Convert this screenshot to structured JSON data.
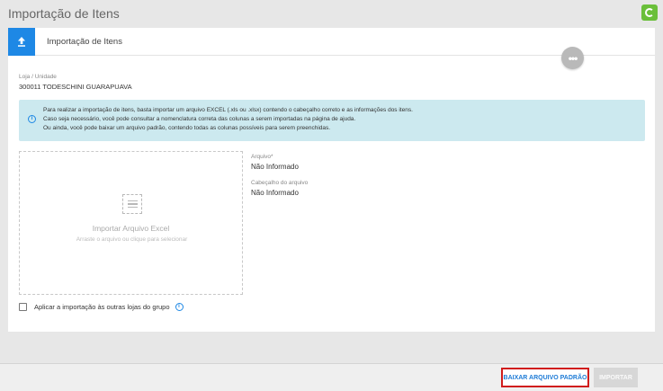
{
  "header": {
    "title": "Importação de Itens",
    "corner_icon": "refresh-icon"
  },
  "card": {
    "title": "Importação de Itens",
    "upload_icon": "upload-icon"
  },
  "more_button": {
    "label": "•••"
  },
  "store": {
    "label": "Loja / Unidade",
    "value": "300011 TODESCHINI GUARAPUAVA"
  },
  "info": {
    "lines": [
      "Para realizar a importação de itens, basta importar um arquivo EXCEL (.xls ou .xlsx) contendo o cabeçalho correto e as informações dos itens.",
      "Caso seja necessário, você pode consultar a nomenclatura correta das colunas a serem importadas na página de ajuda.",
      "Ou ainda, você pode baixar um arquivo padrão, contendo todas as colunas possíveis para serem preenchidas."
    ]
  },
  "dropzone": {
    "title": "Importar Arquivo Excel",
    "subtitle": "Arraste o arquivo ou clique para selecionar"
  },
  "fields": {
    "file": {
      "label": "Arquivo*",
      "value": "Não Informado"
    },
    "header": {
      "label": "Cabeçalho do arquivo",
      "value": "Não Informado"
    }
  },
  "apply_group": {
    "label": "Aplicar a importação às outras lojas do grupo",
    "checked": false
  },
  "footer": {
    "download_label": "BAIXAR ARQUIVO PADRÃO",
    "import_label": "IMPORTAR"
  },
  "colors": {
    "accent": "#1e88e5",
    "info_bg": "#cce9ef",
    "highlight_border": "#d01c1c",
    "brand_green": "#6abf3a"
  }
}
